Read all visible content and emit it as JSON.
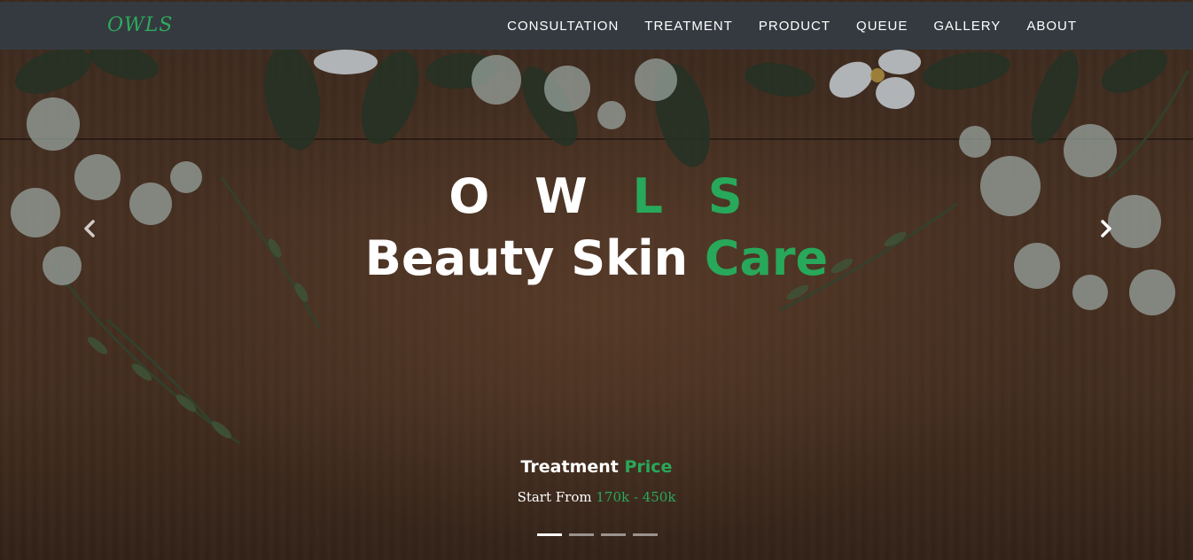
{
  "navbar": {
    "brand": "OWLS",
    "links": [
      "CONSULTATION",
      "TREATMENT",
      "PRODUCT",
      "QUEUE",
      "GALLERY",
      "ABOUT"
    ]
  },
  "hero": {
    "title_letters": [
      "O",
      "W",
      "L",
      "S"
    ],
    "subtitle_white": "Beauty Skin",
    "subtitle_green": "Care"
  },
  "caption": {
    "title_white": "Treatment",
    "title_green": "Price",
    "text_white": "Start From",
    "text_green": "170k - 450k"
  },
  "carousel": {
    "slide_count": 4,
    "active_index": 0
  },
  "colors": {
    "accent_green": "#28a85a",
    "navbar_bg": "#353a40",
    "text_white": "#ffffff"
  },
  "icons": {
    "prev": "chevron-left-icon",
    "next": "chevron-right-icon"
  }
}
